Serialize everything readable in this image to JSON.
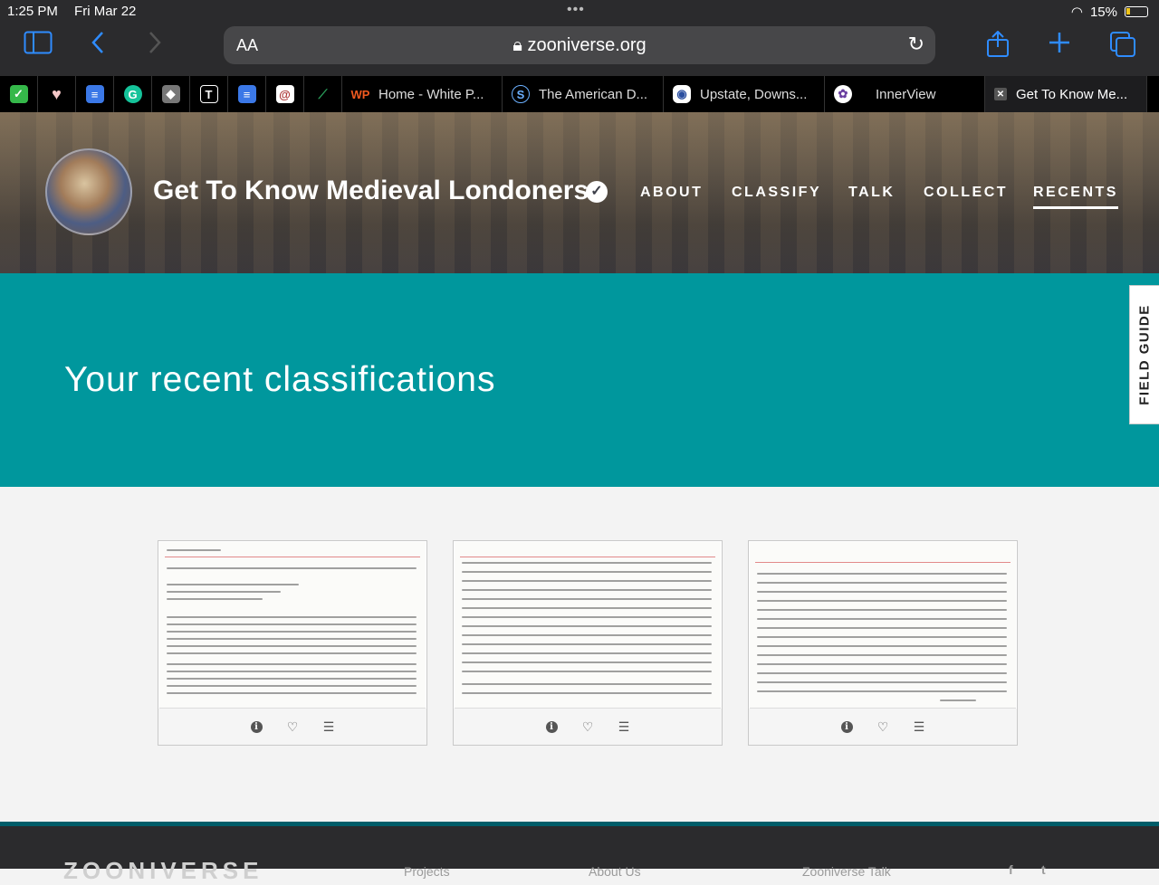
{
  "status_bar": {
    "time": "1:25 PM",
    "date": "Fri Mar 22",
    "battery": "15%"
  },
  "browser": {
    "text_size_label": "AA",
    "url": "zooniverse.org",
    "accent": "#2f8cff"
  },
  "tabs": [
    {
      "label": "Home - White P...",
      "icon": "wp-icon"
    },
    {
      "label": "The American D...",
      "icon": "s-icon"
    },
    {
      "label": "Upstate, Downs...",
      "icon": "podcast-icon"
    },
    {
      "label": "InnerView",
      "icon": "innerview-icon"
    },
    {
      "label": "Get To Know Me...",
      "icon": "close-icon"
    }
  ],
  "project": {
    "title": "Get To Know Medieval Londoners",
    "nav": [
      "ABOUT",
      "CLASSIFY",
      "TALK",
      "COLLECT",
      "RECENTS"
    ],
    "active_nav": "RECENTS"
  },
  "page": {
    "heading": "Your recent classifications",
    "field_guide": "FIELD GUIDE",
    "teal_color": "#00979d"
  },
  "footer": {
    "logo": "ZOONIVERSE",
    "links": [
      "Projects",
      "About Us",
      "Zooniverse Talk"
    ],
    "social": [
      "f",
      "t"
    ]
  }
}
